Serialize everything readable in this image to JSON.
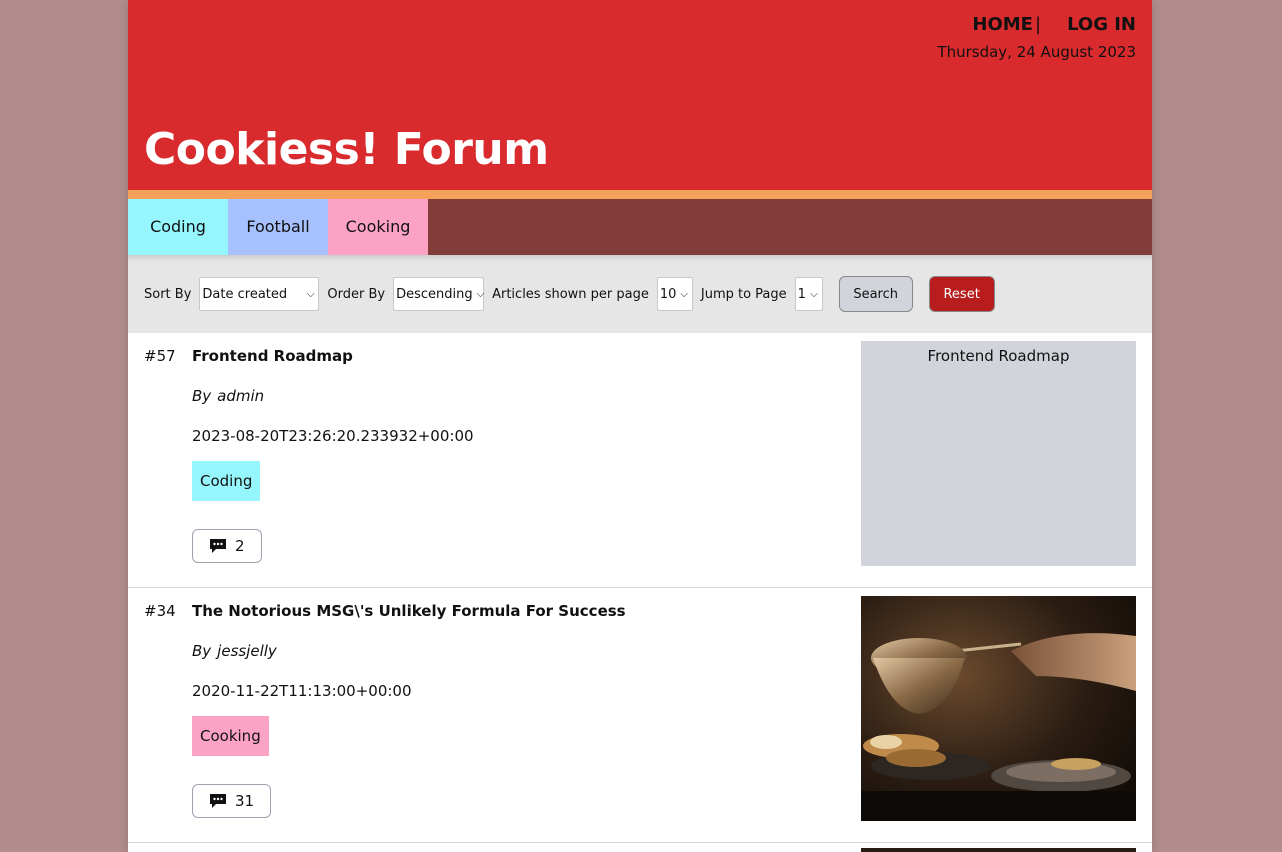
{
  "topnav": {
    "home": "HOME",
    "separator": "|",
    "login": "LOG IN"
  },
  "date": "Thursday, 24 August 2023",
  "site_title": "Cookiess! Forum",
  "categories": [
    {
      "label": "Coding",
      "color": "#96f6fd"
    },
    {
      "label": "Football",
      "color": "#a6c1fd"
    },
    {
      "label": "Cooking",
      "color": "#fca3c5"
    }
  ],
  "filters": {
    "sort_by_label": "Sort By",
    "sort_by_value": "Date created",
    "order_by_label": "Order By",
    "order_by_value": "Descending",
    "per_page_label": "Articles shown per page",
    "per_page_value": "10",
    "jump_label": "Jump to Page",
    "jump_value": "1",
    "search": "Search",
    "reset": "Reset"
  },
  "articles": [
    {
      "id": "#57",
      "title": "Frontend Roadmap",
      "by": "By",
      "author": "admin",
      "date": "2023-08-20T23:26:20.233932+00:00",
      "tag": "Coding",
      "comments": "2",
      "thumbnail_alt": "Frontend Roadmap"
    },
    {
      "id": "#34",
      "title": "The Notorious MSG\\'s Unlikely Formula For Success",
      "by": "By",
      "author": "jessjelly",
      "date": "2020-11-22T11:13:00+00:00",
      "tag": "Cooking",
      "comments": "31"
    }
  ],
  "colors": {
    "header": "#d92b2e",
    "stripe": "#f4a25a",
    "category_bar": "#823d3b",
    "filter_bar": "#e6e6e6",
    "reset_button": "#b91c1c",
    "background": "#b08c8c"
  }
}
